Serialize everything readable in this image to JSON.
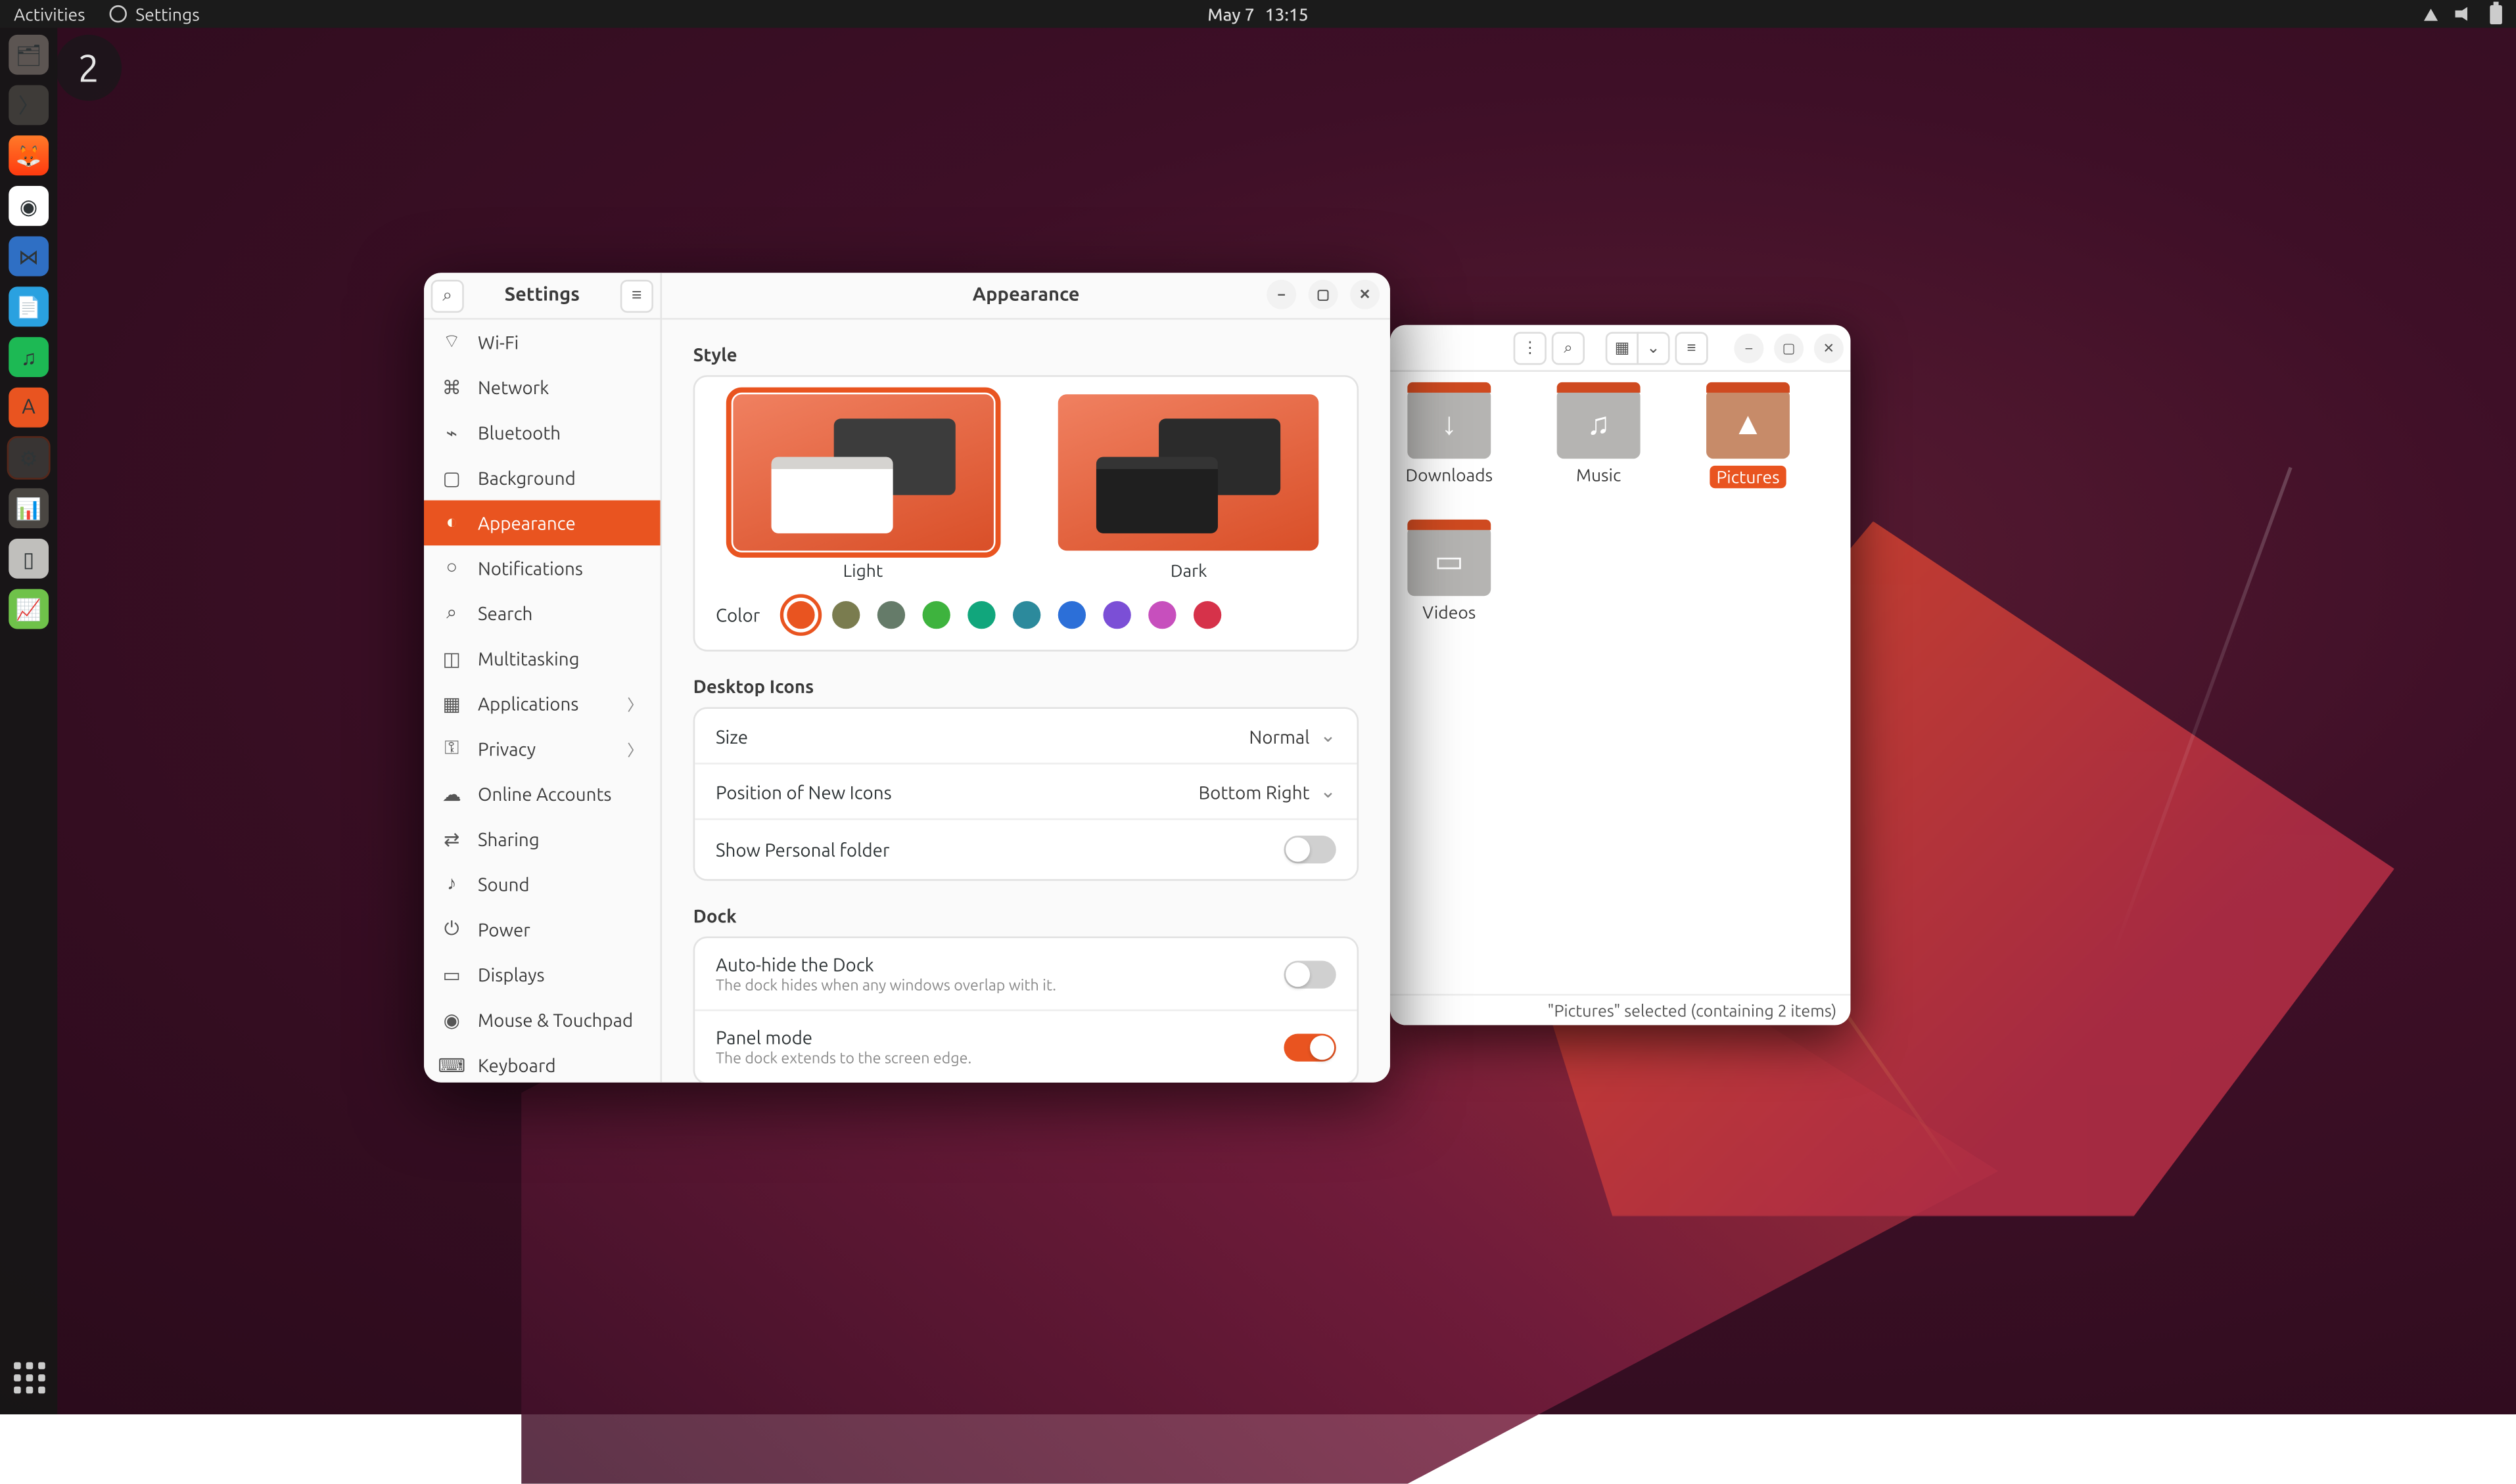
{
  "topbar": {
    "activities": "Activities",
    "app_name": "Settings",
    "date": "May 7",
    "time": "13:15"
  },
  "notif_count": "2",
  "dock": {
    "items": [
      "files-icon",
      "terminal-icon",
      "firefox-icon",
      "chrome-icon",
      "vscode-icon",
      "writer-icon",
      "spotify-icon",
      "software-icon",
      "settings-icon",
      "impress-icon",
      "disk-icon",
      "calc-icon"
    ]
  },
  "files": {
    "status": "\"Pictures\" selected  (containing 2 items)",
    "folders": [
      {
        "label": "Downloads",
        "glyph": "↓",
        "sel": false
      },
      {
        "label": "Music",
        "glyph": "♫",
        "sel": false
      },
      {
        "label": "Pictures",
        "glyph": "▲",
        "sel": true
      },
      {
        "label": "Videos",
        "glyph": "▭",
        "sel": false
      }
    ]
  },
  "settings": {
    "side_title": "Settings",
    "main_title": "Appearance",
    "nav": [
      {
        "label": "Wi-Fi",
        "icon": "⌔",
        "chev": false
      },
      {
        "label": "Network",
        "icon": "⌘",
        "chev": false
      },
      {
        "label": "Bluetooth",
        "icon": "⌁",
        "chev": false
      },
      {
        "label": "Background",
        "icon": "▢",
        "chev": false
      },
      {
        "label": "Appearance",
        "icon": "◐",
        "chev": false,
        "active": true
      },
      {
        "label": "Notifications",
        "icon": "○",
        "chev": false
      },
      {
        "label": "Search",
        "icon": "⌕",
        "chev": false
      },
      {
        "label": "Multitasking",
        "icon": "◫",
        "chev": false
      },
      {
        "label": "Applications",
        "icon": "▦",
        "chev": true
      },
      {
        "label": "Privacy",
        "icon": "⚿",
        "chev": true
      },
      {
        "label": "Online Accounts",
        "icon": "☁",
        "chev": false
      },
      {
        "label": "Sharing",
        "icon": "⇄",
        "chev": false
      },
      {
        "label": "Sound",
        "icon": "♪",
        "chev": false
      },
      {
        "label": "Power",
        "icon": "⏻",
        "chev": false
      },
      {
        "label": "Displays",
        "icon": "▭",
        "chev": false
      },
      {
        "label": "Mouse & Touchpad",
        "icon": "◉",
        "chev": false
      },
      {
        "label": "Keyboard",
        "icon": "⌨",
        "chev": false
      }
    ],
    "sections": {
      "style_title": "Style",
      "style_light": "Light",
      "style_dark": "Dark",
      "color_label": "Color",
      "colors": [
        "#e95420",
        "#7a7c4f",
        "#657b69",
        "#3eb33e",
        "#11a67c",
        "#2c8a9c",
        "#2c6fd8",
        "#7b4fd6",
        "#c74fbd",
        "#d6324a"
      ],
      "desktop_icons_title": "Desktop Icons",
      "size_label": "Size",
      "size_value": "Normal",
      "pos_label": "Position of New Icons",
      "pos_value": "Bottom Right",
      "show_personal_label": "Show Personal folder",
      "dock_title": "Dock",
      "auto_hide_label": "Auto-hide the Dock",
      "auto_hide_sub": "The dock hides when any windows overlap with it.",
      "panel_mode_label": "Panel mode",
      "panel_mode_sub": "The dock extends to the screen edge."
    }
  }
}
